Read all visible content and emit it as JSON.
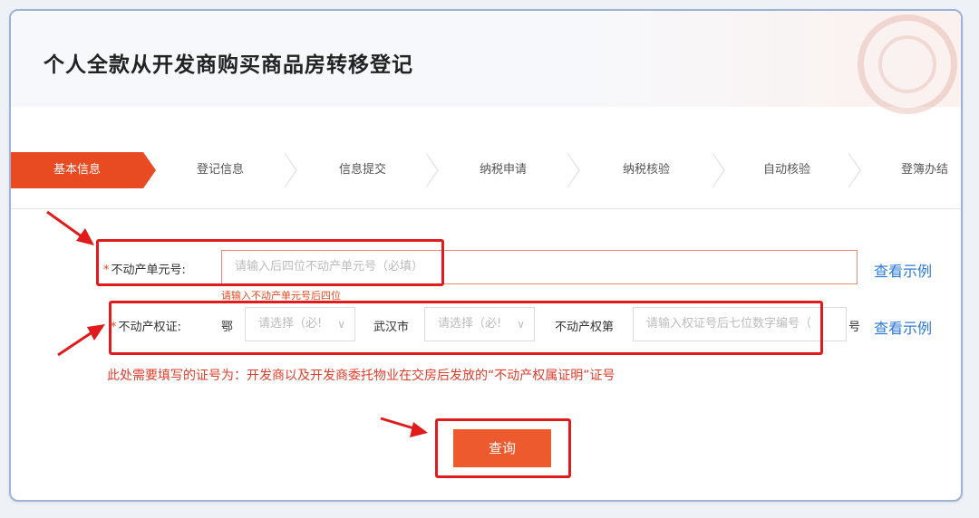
{
  "page": {
    "title": "个人全款从开发商购买商品房转移登记"
  },
  "steps": [
    {
      "label": "基本信息",
      "active": true
    },
    {
      "label": "登记信息",
      "active": false
    },
    {
      "label": "信息提交",
      "active": false
    },
    {
      "label": "纳税申请",
      "active": false
    },
    {
      "label": "纳税核验",
      "active": false
    },
    {
      "label": "自动核验",
      "active": false
    },
    {
      "label": "登簿办结",
      "active": false
    }
  ],
  "form": {
    "unit": {
      "required_mark": "*",
      "label": "不动产单元号:",
      "placeholder": "请输入后四位不动产单元号（必填）",
      "error": "请输入不动产单元号后四位",
      "example_link": "查看示例"
    },
    "cert": {
      "required_mark": "*",
      "label": "不动产权证:",
      "prefix": "鄂",
      "select1_placeholder": "请选择（必!",
      "city": "武汉市",
      "select2_placeholder": "请选择（必!",
      "mid_label": "不动产权第",
      "placeholder": "请输入权证号后七位数字编号（",
      "suffix": "号",
      "example_link": "查看示例"
    },
    "notice": "此处需要填写的证号为：开发商以及开发商委托物业在交房后发放的“不动产权属证明”证号"
  },
  "actions": {
    "query_label": "查询"
  },
  "colors": {
    "accent": "#e84a22",
    "annotation": "#e11b1b",
    "link": "#2b79d8"
  }
}
